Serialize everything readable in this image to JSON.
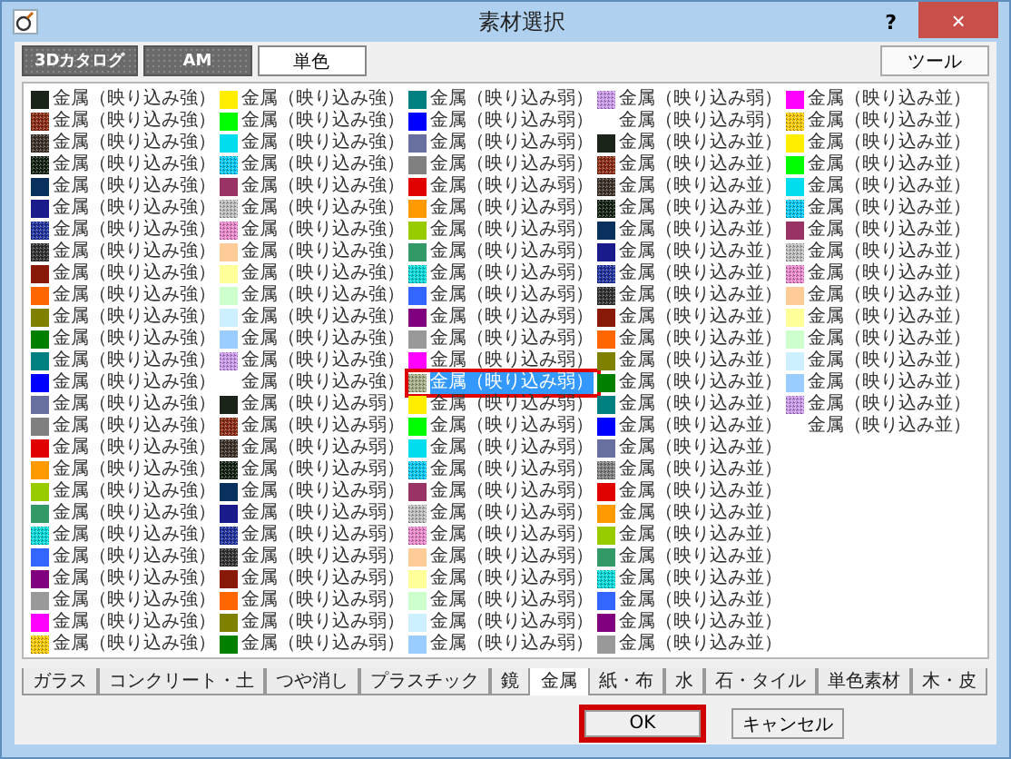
{
  "window": {
    "title": "素材選択",
    "help": "?",
    "close": "×"
  },
  "top_tabs": [
    {
      "label": "3Dカタログ",
      "selected": false
    },
    {
      "label": "AM",
      "selected": false
    },
    {
      "label": "単色",
      "selected": true
    }
  ],
  "tool_button": "ツール",
  "columns": [
    [
      {
        "label": "金属（映り込み強）",
        "color": "#1a2418",
        "textured": false,
        "selected": false
      },
      {
        "label": "金属（映り込み強）",
        "color": "#8b2a10",
        "textured": true,
        "selected": false
      },
      {
        "label": "金属（映り込み強）",
        "color": "#3a3028",
        "textured": true,
        "selected": false
      },
      {
        "label": "金属（映り込み強）",
        "color": "#102010",
        "textured": true,
        "selected": false
      },
      {
        "label": "金属（映り込み強）",
        "color": "#0a3060",
        "textured": false,
        "selected": false
      },
      {
        "label": "金属（映り込み強）",
        "color": "#1a1a8a",
        "textured": false,
        "selected": false
      },
      {
        "label": "金属（映り込み強）",
        "color": "#2030a0",
        "textured": true,
        "selected": false
      },
      {
        "label": "金属（映り込み強）",
        "color": "#303030",
        "textured": true,
        "selected": false
      },
      {
        "label": "金属（映り込み強）",
        "color": "#8a1a08",
        "textured": false,
        "selected": false
      },
      {
        "label": "金属（映り込み強）",
        "color": "#ff6600",
        "textured": false,
        "selected": false
      },
      {
        "label": "金属（映り込み強）",
        "color": "#808000",
        "textured": false,
        "selected": false
      },
      {
        "label": "金属（映り込み強）",
        "color": "#008000",
        "textured": false,
        "selected": false
      },
      {
        "label": "金属（映り込み強）",
        "color": "#008080",
        "textured": false,
        "selected": false
      },
      {
        "label": "金属（映り込み強）",
        "color": "#0000ff",
        "textured": false,
        "selected": false
      },
      {
        "label": "金属（映り込み強）",
        "color": "#6870a0",
        "textured": false,
        "selected": false
      },
      {
        "label": "金属（映り込み強）",
        "color": "#808080",
        "textured": false,
        "selected": false
      },
      {
        "label": "金属（映り込み強）",
        "color": "#e00000",
        "textured": false,
        "selected": false
      },
      {
        "label": "金属（映り込み強）",
        "color": "#ff9900",
        "textured": false,
        "selected": false
      },
      {
        "label": "金属（映り込み強）",
        "color": "#99cc00",
        "textured": false,
        "selected": false
      },
      {
        "label": "金属（映り込み強）",
        "color": "#339966",
        "textured": false,
        "selected": false
      },
      {
        "label": "金属（映り込み強）",
        "color": "#00dddd",
        "textured": true,
        "selected": false
      },
      {
        "label": "金属（映り込み強）",
        "color": "#3366ff",
        "textured": false,
        "selected": false
      },
      {
        "label": "金属（映り込み強）",
        "color": "#800080",
        "textured": false,
        "selected": false
      },
      {
        "label": "金属（映り込み強）",
        "color": "#999999",
        "textured": false,
        "selected": false
      },
      {
        "label": "金属（映り込み強）",
        "color": "#ff00ff",
        "textured": false,
        "selected": false
      },
      {
        "label": "金属（映り込み強）",
        "color": "#ffcc00",
        "textured": true,
        "selected": false
      }
    ],
    [
      {
        "label": "金属（映り込み強）",
        "color": "#ffee00",
        "textured": false,
        "selected": false
      },
      {
        "label": "金属（映り込み強）",
        "color": "#00ff00",
        "textured": false,
        "selected": false
      },
      {
        "label": "金属（映り込み強）",
        "color": "#00ddee",
        "textured": false,
        "selected": false
      },
      {
        "label": "金属（映り込み強）",
        "color": "#00ccff",
        "textured": true,
        "selected": false
      },
      {
        "label": "金属（映り込み強）",
        "color": "#993366",
        "textured": false,
        "selected": false
      },
      {
        "label": "金属（映り込み強）",
        "color": "#c0c0c0",
        "textured": true,
        "selected": false
      },
      {
        "label": "金属（映り込み強）",
        "color": "#ee88cc",
        "textured": true,
        "selected": false
      },
      {
        "label": "金属（映り込み強）",
        "color": "#ffcc99",
        "textured": false,
        "selected": false
      },
      {
        "label": "金属（映り込み強）",
        "color": "#ffff99",
        "textured": false,
        "selected": false
      },
      {
        "label": "金属（映り込み強）",
        "color": "#ccffcc",
        "textured": false,
        "selected": false
      },
      {
        "label": "金属（映り込み強）",
        "color": "#ccf0ff",
        "textured": false,
        "selected": false
      },
      {
        "label": "金属（映り込み強）",
        "color": "#99ccff",
        "textured": false,
        "selected": false
      },
      {
        "label": "金属（映り込み強）",
        "color": "#cc99ee",
        "textured": true,
        "selected": false
      },
      {
        "label": "金属（映り込み強）",
        "selected": false
      },
      {
        "label": "金属（映り込み弱）",
        "color": "#1a2418",
        "textured": false,
        "selected": false
      },
      {
        "label": "金属（映り込み弱）",
        "color": "#8b2a10",
        "textured": true,
        "selected": false
      },
      {
        "label": "金属（映り込み弱）",
        "color": "#3a3028",
        "textured": true,
        "selected": false
      },
      {
        "label": "金属（映り込み弱）",
        "color": "#102010",
        "textured": true,
        "selected": false
      },
      {
        "label": "金属（映り込み弱）",
        "color": "#0a3060",
        "textured": false,
        "selected": false
      },
      {
        "label": "金属（映り込み弱）",
        "color": "#1a1a8a",
        "textured": false,
        "selected": false
      },
      {
        "label": "金属（映り込み弱）",
        "color": "#2030a0",
        "textured": true,
        "selected": false
      },
      {
        "label": "金属（映り込み弱）",
        "color": "#303030",
        "textured": true,
        "selected": false
      },
      {
        "label": "金属（映り込み弱）",
        "color": "#8a1a08",
        "textured": false,
        "selected": false
      },
      {
        "label": "金属（映り込み弱）",
        "color": "#ff6600",
        "textured": false,
        "selected": false
      },
      {
        "label": "金属（映り込み弱）",
        "color": "#808000",
        "textured": false,
        "selected": false
      },
      {
        "label": "金属（映り込み弱）",
        "color": "#008000",
        "textured": false,
        "selected": false
      }
    ],
    [
      {
        "label": "金属（映り込み弱）",
        "color": "#008080",
        "textured": false,
        "selected": false
      },
      {
        "label": "金属（映り込み弱）",
        "color": "#0000ff",
        "textured": false,
        "selected": false
      },
      {
        "label": "金属（映り込み弱）",
        "color": "#6870a0",
        "textured": false,
        "selected": false
      },
      {
        "label": "金属（映り込み弱）",
        "color": "#808080",
        "textured": false,
        "selected": false
      },
      {
        "label": "金属（映り込み弱）",
        "color": "#e00000",
        "textured": false,
        "selected": false
      },
      {
        "label": "金属（映り込み弱）",
        "color": "#ff9900",
        "textured": false,
        "selected": false
      },
      {
        "label": "金属（映り込み弱）",
        "color": "#99cc00",
        "textured": false,
        "selected": false
      },
      {
        "label": "金属（映り込み弱）",
        "color": "#339966",
        "textured": false,
        "selected": false
      },
      {
        "label": "金属（映り込み弱）",
        "color": "#00dddd",
        "textured": true,
        "selected": false
      },
      {
        "label": "金属（映り込み弱）",
        "color": "#3366ff",
        "textured": false,
        "selected": false
      },
      {
        "label": "金属（映り込み弱）",
        "color": "#800080",
        "textured": false,
        "selected": false
      },
      {
        "label": "金属（映り込み弱）",
        "color": "#999999",
        "textured": false,
        "selected": false
      },
      {
        "label": "金属（映り込み弱）",
        "color": "#ff00ff",
        "textured": false,
        "selected": false
      },
      {
        "label": "金属（映り込み弱）",
        "color": "#a8b088",
        "textured": true,
        "selected": true,
        "callout": true
      },
      {
        "label": "金属（映り込み弱）",
        "color": "#ffee00",
        "textured": false,
        "selected": false
      },
      {
        "label": "金属（映り込み弱）",
        "color": "#00ff00",
        "textured": false,
        "selected": false
      },
      {
        "label": "金属（映り込み弱）",
        "color": "#00ddee",
        "textured": false,
        "selected": false
      },
      {
        "label": "金属（映り込み弱）",
        "color": "#00ccff",
        "textured": true,
        "selected": false
      },
      {
        "label": "金属（映り込み弱）",
        "color": "#993366",
        "textured": false,
        "selected": false
      },
      {
        "label": "金属（映り込み弱）",
        "color": "#c0c0c0",
        "textured": true,
        "selected": false
      },
      {
        "label": "金属（映り込み弱）",
        "color": "#ee88cc",
        "textured": true,
        "selected": false
      },
      {
        "label": "金属（映り込み弱）",
        "color": "#ffcc99",
        "textured": false,
        "selected": false
      },
      {
        "label": "金属（映り込み弱）",
        "color": "#ffff99",
        "textured": false,
        "selected": false
      },
      {
        "label": "金属（映り込み弱）",
        "color": "#ccffcc",
        "textured": false,
        "selected": false
      },
      {
        "label": "金属（映り込み弱）",
        "color": "#ccf0ff",
        "textured": false,
        "selected": false
      },
      {
        "label": "金属（映り込み弱）",
        "color": "#99ccff",
        "textured": false,
        "selected": false
      }
    ],
    [
      {
        "label": "金属（映り込み弱）",
        "color": "#cc99ee",
        "textured": true,
        "selected": false
      },
      {
        "label": "金属（映り込み弱）",
        "selected": false
      },
      {
        "label": "金属（映り込み並）",
        "color": "#1a2418",
        "textured": false,
        "selected": false
      },
      {
        "label": "金属（映り込み並）",
        "color": "#8b2a10",
        "textured": true,
        "selected": false
      },
      {
        "label": "金属（映り込み並）",
        "color": "#3a3028",
        "textured": true,
        "selected": false
      },
      {
        "label": "金属（映り込み並）",
        "color": "#102010",
        "textured": true,
        "selected": false
      },
      {
        "label": "金属（映り込み並）",
        "color": "#0a3060",
        "textured": false,
        "selected": false
      },
      {
        "label": "金属（映り込み並）",
        "color": "#1a1a8a",
        "textured": false,
        "selected": false
      },
      {
        "label": "金属（映り込み並）",
        "color": "#2030a0",
        "textured": true,
        "selected": false
      },
      {
        "label": "金属（映り込み並）",
        "color": "#303030",
        "textured": true,
        "selected": false
      },
      {
        "label": "金属（映り込み並）",
        "color": "#8a1a08",
        "textured": false,
        "selected": false
      },
      {
        "label": "金属（映り込み並）",
        "color": "#ff6600",
        "textured": false,
        "selected": false
      },
      {
        "label": "金属（映り込み並）",
        "color": "#808000",
        "textured": false,
        "selected": false
      },
      {
        "label": "金属（映り込み並）",
        "color": "#008000",
        "textured": false,
        "selected": false
      },
      {
        "label": "金属（映り込み並）",
        "color": "#008080",
        "textured": false,
        "selected": false
      },
      {
        "label": "金属（映り込み並）",
        "color": "#0000ff",
        "textured": false,
        "selected": false
      },
      {
        "label": "金属（映り込み並）",
        "color": "#6870a0",
        "textured": false,
        "selected": false
      },
      {
        "label": "金属（映り込み並）",
        "color": "#808080",
        "textured": true,
        "selected": false
      },
      {
        "label": "金属（映り込み並）",
        "color": "#e00000",
        "textured": false,
        "selected": false
      },
      {
        "label": "金属（映り込み並）",
        "color": "#ff9900",
        "textured": false,
        "selected": false
      },
      {
        "label": "金属（映り込み並）",
        "color": "#99cc00",
        "textured": false,
        "selected": false
      },
      {
        "label": "金属（映り込み並）",
        "color": "#339966",
        "textured": false,
        "selected": false
      },
      {
        "label": "金属（映り込み並）",
        "color": "#00dddd",
        "textured": true,
        "selected": false
      },
      {
        "label": "金属（映り込み並）",
        "color": "#3366ff",
        "textured": false,
        "selected": false
      },
      {
        "label": "金属（映り込み並）",
        "color": "#800080",
        "textured": false,
        "selected": false
      },
      {
        "label": "金属（映り込み並）",
        "color": "#999999",
        "textured": false,
        "selected": false
      }
    ],
    [
      {
        "label": "金属（映り込み並）",
        "color": "#ff00ff",
        "textured": false,
        "selected": false
      },
      {
        "label": "金属（映り込み並）",
        "color": "#ffcc00",
        "textured": true,
        "selected": false
      },
      {
        "label": "金属（映り込み並）",
        "color": "#ffee00",
        "textured": false,
        "selected": false
      },
      {
        "label": "金属（映り込み並）",
        "color": "#00ff00",
        "textured": false,
        "selected": false
      },
      {
        "label": "金属（映り込み並）",
        "color": "#00ddee",
        "textured": false,
        "selected": false
      },
      {
        "label": "金属（映り込み並）",
        "color": "#00ccff",
        "textured": true,
        "selected": false
      },
      {
        "label": "金属（映り込み並）",
        "color": "#993366",
        "textured": false,
        "selected": false
      },
      {
        "label": "金属（映り込み並）",
        "color": "#c0c0c0",
        "textured": true,
        "selected": false
      },
      {
        "label": "金属（映り込み並）",
        "color": "#ee88cc",
        "textured": true,
        "selected": false
      },
      {
        "label": "金属（映り込み並）",
        "color": "#ffcc99",
        "textured": false,
        "selected": false
      },
      {
        "label": "金属（映り込み並）",
        "color": "#ffff99",
        "textured": false,
        "selected": false
      },
      {
        "label": "金属（映り込み並）",
        "color": "#ccffcc",
        "textured": false,
        "selected": false
      },
      {
        "label": "金属（映り込み並）",
        "color": "#ccf0ff",
        "textured": false,
        "selected": false
      },
      {
        "label": "金属（映り込み並）",
        "color": "#99ccff",
        "textured": false,
        "selected": false
      },
      {
        "label": "金属（映り込み並）",
        "color": "#cc99ee",
        "textured": true,
        "selected": false
      },
      {
        "label": "金属（映り込み並）",
        "selected": false
      }
    ]
  ],
  "bottom_tabs": [
    {
      "label": "ガラス",
      "selected": false
    },
    {
      "label": "コンクリート・土",
      "selected": false
    },
    {
      "label": "つや消し",
      "selected": false
    },
    {
      "label": "プラスチック",
      "selected": false
    },
    {
      "label": "鏡",
      "selected": false
    },
    {
      "label": "金属",
      "selected": true
    },
    {
      "label": "紙・布",
      "selected": false
    },
    {
      "label": "水",
      "selected": false
    },
    {
      "label": "石・タイル",
      "selected": false
    },
    {
      "label": "単色素材",
      "selected": false
    },
    {
      "label": "木・皮",
      "selected": false
    }
  ],
  "buttons": [
    {
      "label": "OK",
      "callout": true
    },
    {
      "label": "キャンセル",
      "callout": false
    }
  ]
}
